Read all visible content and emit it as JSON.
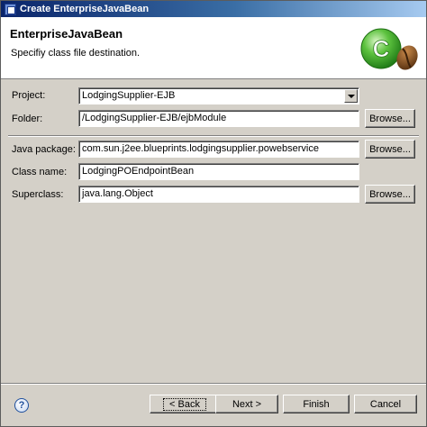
{
  "window": {
    "title": "Create EnterpriseJavaBean",
    "icon": "ejb-wizard-icon"
  },
  "banner": {
    "title": "EnterpriseJavaBean",
    "subtitle": "Specifiy class file destination.",
    "logo_letter": "C",
    "logo_icon": "java-class-bean-icon",
    "colors": {
      "green": "#3da72b",
      "bean": "#7a4a1c"
    }
  },
  "form": {
    "project": {
      "label": "Project:",
      "value": "LodgingSupplier-EJB"
    },
    "folder": {
      "label": "Folder:",
      "value": "/LodgingSupplier-EJB/ejbModule",
      "browse_label": "Browse..."
    },
    "java_package": {
      "label": "Java package:",
      "value": "com.sun.j2ee.blueprints.lodgingsupplier.powebservice",
      "browse_label": "Browse..."
    },
    "class_name": {
      "label": "Class name:",
      "value": "LodgingPOEndpointBean"
    },
    "superclass": {
      "label": "Superclass:",
      "value": "java.lang.Object",
      "browse_label": "Browse..."
    }
  },
  "footer": {
    "help_icon": "help-icon",
    "help_glyph": "?",
    "back_label": "< Back",
    "next_label": "Next >",
    "finish_label": "Finish",
    "cancel_label": "Cancel"
  }
}
